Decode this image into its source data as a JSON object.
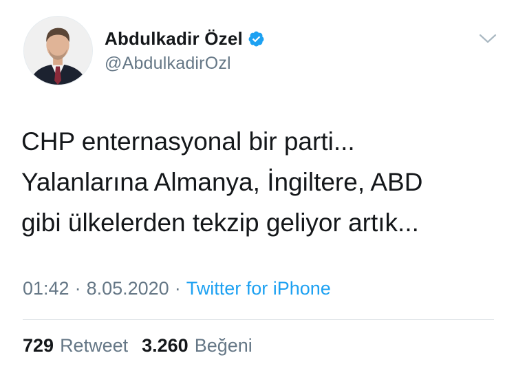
{
  "author": {
    "display_name": "Abdulkadir Özel",
    "handle": "@AbdulkadirOzl",
    "verified": true
  },
  "tweet": {
    "text_lines": [
      "CHP enternasyonal bir parti...",
      "Yalanlarına Almanya, İngiltere, ABD",
      "gibi ülkelerden tekzip geliyor artık..."
    ],
    "time": "01:42",
    "date": "8.05.2020",
    "separator": "·",
    "source": "Twitter for iPhone"
  },
  "stats": {
    "retweet_count": "729",
    "retweet_label": "Retweet",
    "like_count": "3.260",
    "like_label": "Beğeni"
  },
  "icons": {
    "verified": "verified-badge-icon",
    "more": "chevron-down-icon"
  },
  "colors": {
    "text": "#14171a",
    "secondary": "#657786",
    "link": "#1da1f2",
    "verified": "#1da1f2"
  }
}
